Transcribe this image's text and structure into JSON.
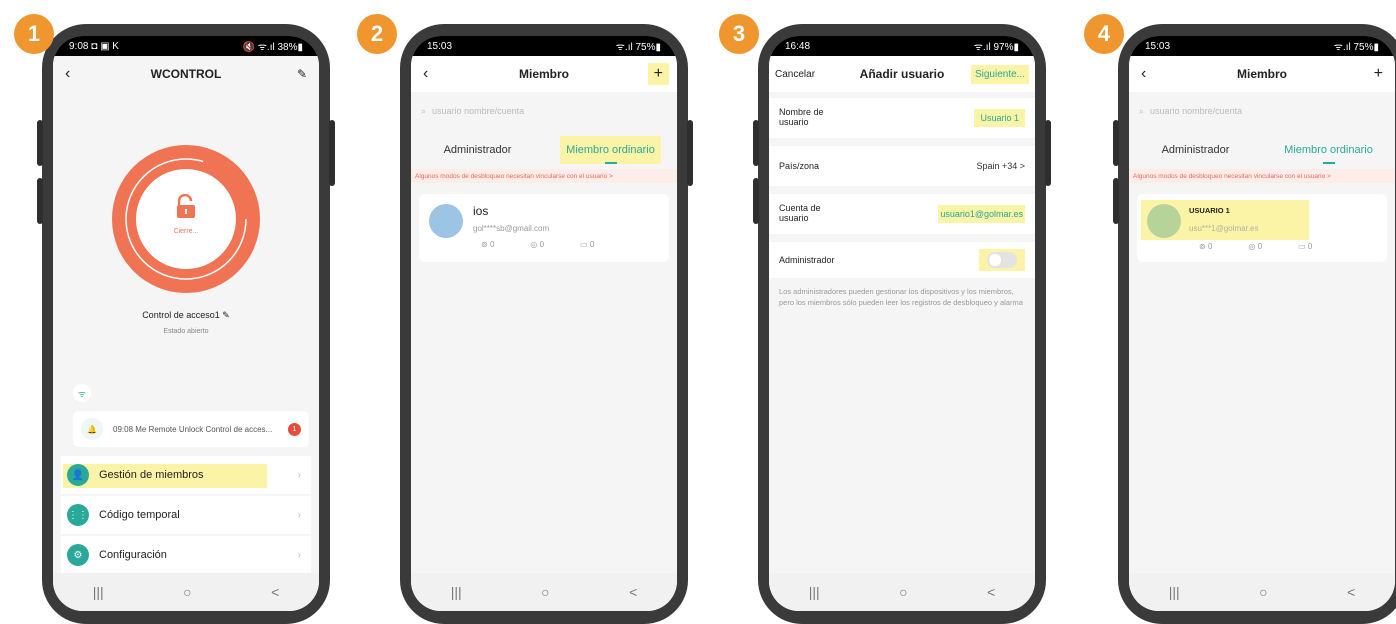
{
  "steps": [
    "1",
    "2",
    "3",
    "4"
  ],
  "phone1": {
    "status_time": "9:08",
    "status_icons": "◘ ▣ K",
    "status_right": "🔇 ᯤ.ıl 38%▮",
    "title": "WCONTROL",
    "lock_label": "Cierre...",
    "device_name": "Control de acceso1",
    "device_state": "Estado abierto",
    "notification_text": "09:08 Me  Remote Unlock Control de acces...",
    "notification_count": "1",
    "menu": [
      {
        "label": "Gestión de miembros",
        "icon": "user-icon"
      },
      {
        "label": "Código temporal",
        "icon": "keypad-icon"
      },
      {
        "label": "Configuración",
        "icon": "gear-icon"
      }
    ]
  },
  "phone2": {
    "status_time": "15:03",
    "status_right": "ᯤ.ıl 75%▮",
    "title": "Miembro",
    "add": "+",
    "search_placeholder": "usuario nombre/cuenta",
    "tabs": [
      "Administrador",
      "Miembro ordinario"
    ],
    "notice": "Algunos modos de desbloqueo necesitan vincularse con el usuario  >",
    "member": {
      "name": "ios",
      "account": "gol****sb@gmail.com",
      "stats": [
        "0",
        "0",
        "0"
      ]
    }
  },
  "phone3": {
    "status_time": "16:48",
    "status_right": "ᯤ.ıl 97%▮",
    "cancel": "Cancelar",
    "title": "Añadir usuario",
    "next": "Siguiente...",
    "rows": [
      {
        "label": "Nombre de usuario",
        "value": "Usuario 1"
      },
      {
        "label": "País/zona",
        "value": "Spain +34  >"
      },
      {
        "label": "Cuenta de usuario",
        "value": "usuario1@golmar.es"
      },
      {
        "label": "Administrador",
        "value": ""
      }
    ],
    "help": "Los administradores pueden gestionar los dispositivos y los miembros, pero los miembros sólo pueden leer los registros de desbloqueo y alarma"
  },
  "phone4": {
    "status_time": "15:03",
    "status_right": "ᯤ.ıl 75%▮",
    "title": "Miembro",
    "add": "+",
    "search_placeholder": "usuario nombre/cuenta",
    "tabs": [
      "Administrador",
      "Miembro ordinario"
    ],
    "notice": "Algunos modos de desbloqueo necesitan vincularse con el usuario  >",
    "member": {
      "name": "USUARIO 1",
      "account": "usu***1@golmar.es",
      "stats": [
        "0",
        "0",
        "0"
      ]
    }
  },
  "nav": [
    "|||",
    "○",
    "<"
  ],
  "colors": {
    "badge": "#F0962E",
    "accent": "#2aa89a",
    "highlight": "#FBF3A6",
    "lock": "#F07454"
  }
}
